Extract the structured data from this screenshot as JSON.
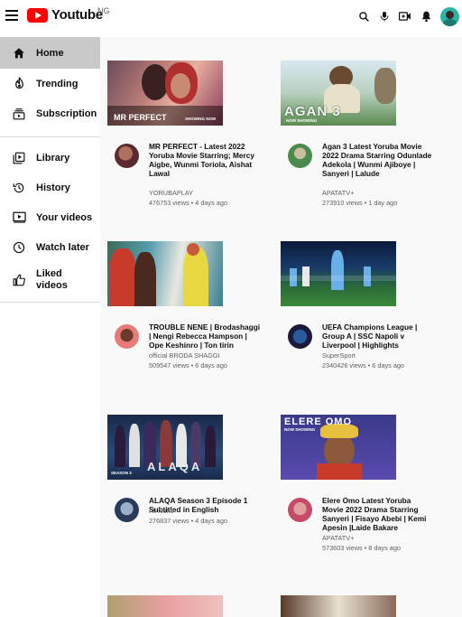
{
  "header": {
    "logo_text": "Youtube",
    "region": "NG",
    "icons": [
      "menu-icon",
      "search-icon",
      "mic-icon",
      "create-video-icon",
      "bell-icon",
      "account-avatar"
    ]
  },
  "sidebar": {
    "items": [
      {
        "label": "Home",
        "icon": "home-icon",
        "active": true
      },
      {
        "label": "Trending",
        "icon": "trending-icon"
      },
      {
        "label": "Subscription",
        "icon": "subscriptions-icon"
      },
      {
        "label": "Library",
        "icon": "library-icon"
      },
      {
        "label": "History",
        "icon": "history-icon"
      },
      {
        "label": "Your videos",
        "icon": "your-videos-icon"
      },
      {
        "label": "Watch later",
        "icon": "watch-later-icon"
      },
      {
        "label": "Liked videos",
        "icon": "liked-icon"
      }
    ]
  },
  "videos": [
    {
      "title": "MR PERFECT - Latest 2022 Yoruba Movie Starring; Mercy Aigbe, Wunmi Toriola, Aishat Lawal",
      "channel": "YORUBAPLAY",
      "stats": "476753 views • 4 days ago",
      "thumb_text": "MR PERFECT",
      "thumb_badge": "SHOWING NOW"
    },
    {
      "title": "Agan 3 Latest Yoruba Movie 2022 Drama Starring Odunlade Adekola | Wunmi Ajiboye | Sanyeri | Lalude",
      "channel": "APATATV+",
      "stats": "273910 views • 1 day ago",
      "thumb_text": "AGAN 3",
      "thumb_badge": "NOW SHOWING"
    },
    {
      "title": "TROUBLE NENE | Brodashaggi | Nengi Rebecca Hampson | Ope Keshinro | Ton tirin",
      "channel": "official BRODA SHAGGI",
      "stats": "509547 views • 6 days ago",
      "thumb_text": "",
      "thumb_badge": ""
    },
    {
      "title": "UEFA Champions League | Group A | SSC Napoli v Liverpool | Highlights",
      "channel": "SuperSport",
      "stats": "2340426 views • 6 days ago",
      "thumb_text": "",
      "thumb_badge": ""
    },
    {
      "title": "ALAQA Season 3 Episode 1 Subtitled in English",
      "channel": "Ali Nuhu",
      "stats": "276837 views • 4 days ago",
      "thumb_text": "ALAQA",
      "thumb_badge": "SEASON 3"
    },
    {
      "title": "Elere Omo Latest Yoruba Movie 2022 Drama Starring Sanyeri | Fisayo Abebi | Kemi Apesin |Laide Bakare",
      "channel": "APATATV+",
      "stats": "573603 views • 8 days ago",
      "thumb_text": "ELERE OMO",
      "thumb_badge": "NOW SHOWING"
    }
  ],
  "colors": {
    "brand": "#ff0000",
    "sidebar_active": "#c9c9c9",
    "text_secondary": "#606060"
  }
}
